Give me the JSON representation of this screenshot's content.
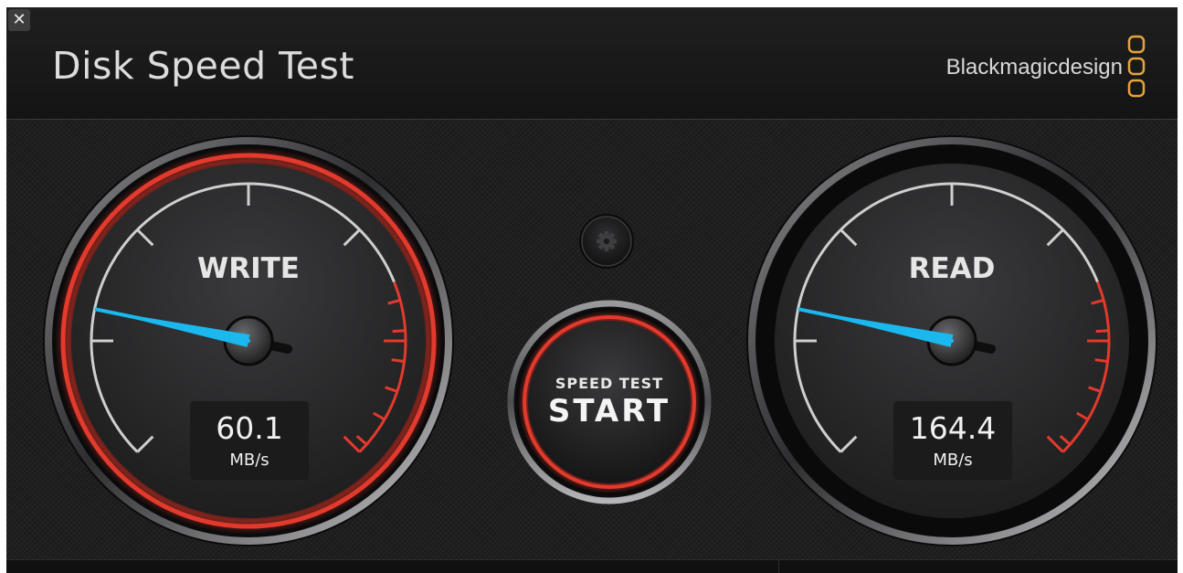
{
  "window": {
    "close_glyph": "✕"
  },
  "header": {
    "title": "Disk Speed Test",
    "brand": "Blackmagicdesign",
    "brand_logo_icon": "blackmagic-logo-icon"
  },
  "colors": {
    "accent_red": "#e23a2c",
    "needle_blue": "#1ab8ee",
    "brand_orange": "#e8a33a"
  },
  "write_gauge": {
    "label": "WRITE",
    "value": "60.1",
    "unit": "MB/s",
    "needle_fraction": 0.21
  },
  "read_gauge": {
    "label": "READ",
    "value": "164.4",
    "unit": "MB/s",
    "needle_fraction": 0.21
  },
  "start_button": {
    "line1": "SPEED TEST",
    "line2": "START"
  },
  "settings_button": {
    "icon": "gear-icon"
  }
}
